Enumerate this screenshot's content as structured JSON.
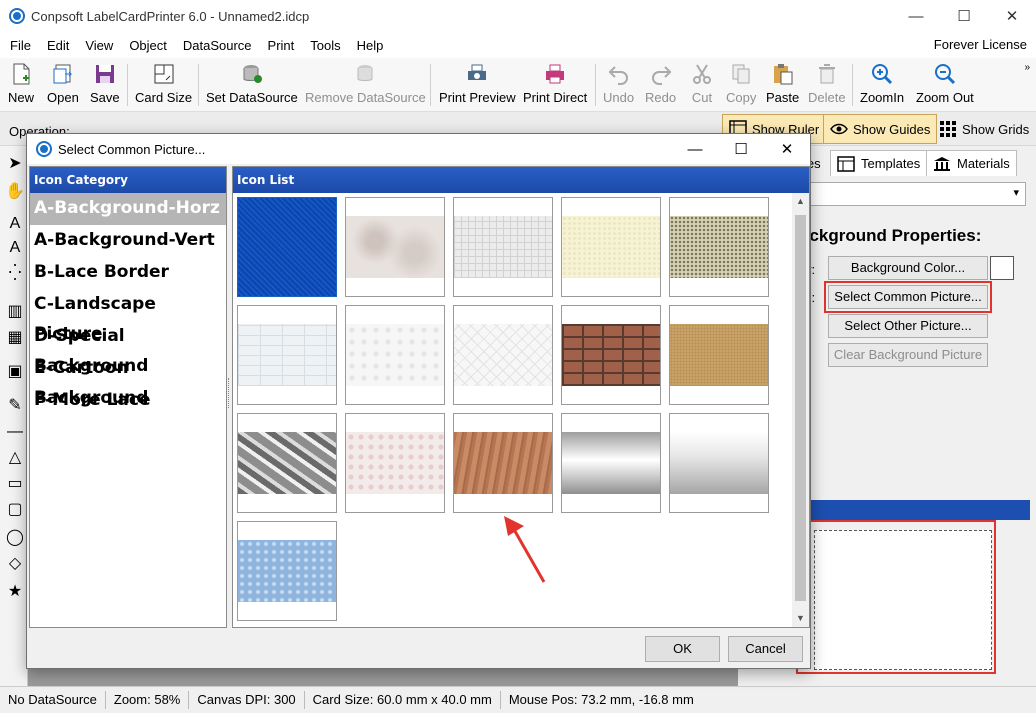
{
  "window": {
    "title": "Conpsoft LabelCardPrinter 6.0 - Unnamed2.idcp",
    "controls": [
      "—",
      "☐",
      "✕"
    ]
  },
  "menu": {
    "items": [
      "File",
      "Edit",
      "View",
      "Object",
      "DataSource",
      "Print",
      "Tools",
      "Help"
    ],
    "license": "Forever License"
  },
  "toolbar": {
    "buttons": [
      {
        "label": "New",
        "icon": "new-file-icon",
        "enabled": true
      },
      {
        "label": "Open",
        "icon": "open-folder-icon",
        "enabled": true
      },
      {
        "label": "Save",
        "icon": "save-disk-icon",
        "enabled": true
      },
      {
        "label": "Card Size",
        "icon": "card-size-icon",
        "enabled": true
      },
      {
        "label": "Set DataSource",
        "icon": "database-icon",
        "enabled": true
      },
      {
        "label": "Remove DataSource",
        "icon": "database-remove-icon",
        "enabled": false
      },
      {
        "label": "Print Preview",
        "icon": "print-preview-icon",
        "enabled": true
      },
      {
        "label": "Print Direct",
        "icon": "printer-icon",
        "enabled": true
      },
      {
        "label": "Undo",
        "icon": "undo-icon",
        "enabled": false
      },
      {
        "label": "Redo",
        "icon": "redo-icon",
        "enabled": false
      },
      {
        "label": "Cut",
        "icon": "scissors-icon",
        "enabled": false
      },
      {
        "label": "Copy",
        "icon": "copy-icon",
        "enabled": false
      },
      {
        "label": "Paste",
        "icon": "paste-icon",
        "enabled": true
      },
      {
        "label": "Delete",
        "icon": "trash-icon",
        "enabled": false
      },
      {
        "label": "ZoomIn",
        "icon": "zoom-in-icon",
        "enabled": true
      },
      {
        "label": "Zoom Out",
        "icon": "zoom-out-icon",
        "enabled": true
      }
    ],
    "overflow": "»"
  },
  "toolbar2": {
    "operation_label": "Operation:",
    "show_ruler": "Show Ruler",
    "show_guides": "Show Guides",
    "show_grids": "Show Grids"
  },
  "right_panel": {
    "tab_properties": "ies",
    "tab_templates": "Templates",
    "tab_materials": "Materials",
    "heading": "ackground Properties:",
    "color_label": "or:",
    "picture_label": "re:",
    "bg_color_button": "Background Color...",
    "select_common_button": "Select Common Picture...",
    "select_other_button": "Select Other Picture...",
    "clear_bg_button": "Clear Background Picture"
  },
  "status": {
    "datasource": "No DataSource",
    "zoom": "Zoom: 58%",
    "dpi": "Canvas DPI: 300",
    "card_size": "Card Size: 60.0 mm x 40.0 mm",
    "mouse_pos": "Mouse Pos: 73.2 mm, -16.8 mm"
  },
  "dialog": {
    "title": "Select Common Picture...",
    "category_header": "Icon Category",
    "categories": [
      "A-Background-Horz",
      "A-Background-Vert",
      "B-Lace Border",
      "C-Landscape Picture",
      "D-Special Background",
      "E-Cartoon Background",
      "F-More Lace"
    ],
    "selected_category": 0,
    "icon_list_header": "Icon List",
    "tiles": [
      {
        "name": "blue-diagonal-pattern"
      },
      {
        "name": "marble-texture"
      },
      {
        "name": "gray-maze-pattern"
      },
      {
        "name": "cream-speckle-texture"
      },
      {
        "name": "olive-speckle-texture"
      },
      {
        "name": "white-brick-texture"
      },
      {
        "name": "white-floral-texture"
      },
      {
        "name": "white-geometric-texture"
      },
      {
        "name": "red-brick-wall"
      },
      {
        "name": "tan-sand-texture"
      },
      {
        "name": "silver-diagonal-streaks"
      },
      {
        "name": "pink-floral-texture"
      },
      {
        "name": "wood-grain-texture"
      },
      {
        "name": "silver-gradient"
      },
      {
        "name": "silver-fade-gradient"
      },
      {
        "name": "blue-water-drops"
      }
    ],
    "ok": "OK",
    "cancel": "Cancel"
  },
  "colors": {
    "accent": "#1c4fb0",
    "highlight": "#e0342c",
    "selected_category": "#b5b5b5"
  }
}
